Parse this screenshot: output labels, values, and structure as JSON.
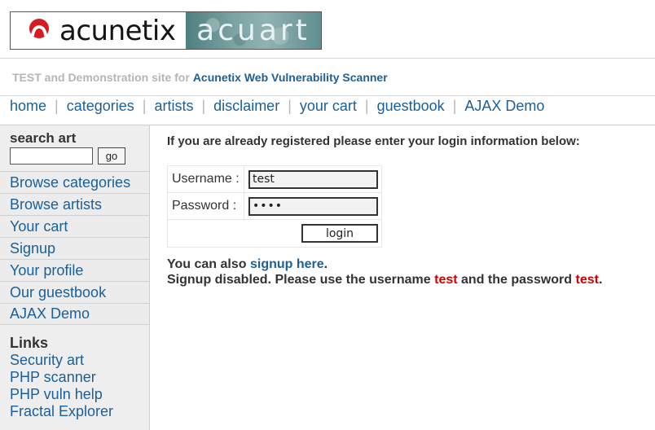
{
  "header": {
    "brand": "acunetix",
    "site_name": "acuart",
    "subtitle_muted": "TEST and Demonstration site for",
    "subtitle_link": "Acunetix Web Vulnerability Scanner"
  },
  "topnav": {
    "items": [
      "home",
      "categories",
      "artists",
      "disclaimer",
      "your cart",
      "guestbook",
      "AJAX Demo"
    ]
  },
  "sidebar": {
    "search_label": "search art",
    "search_input_value": "",
    "search_button": "go",
    "items": [
      "Browse categories",
      "Browse artists",
      "Your cart",
      "Signup",
      "Your profile",
      "Our guestbook",
      "AJAX Demo"
    ],
    "links_title": "Links",
    "links": [
      "Security art",
      "PHP scanner",
      "PHP vuln help",
      "Fractal Explorer"
    ]
  },
  "main": {
    "intro": "If you are already registered please enter your login information below:",
    "username_label": "Username :",
    "username_value": "test",
    "password_label": "Password :",
    "password_value_masked": "••••",
    "login_button": "login",
    "note_prefix": "You can also",
    "note_link": "signup here",
    "note_suffix": ".",
    "disabled_prefix": "Signup disabled. Please use the username",
    "disabled_username": "test",
    "disabled_middle": "and the password",
    "disabled_password": "test",
    "disabled_suffix": "."
  },
  "colors": {
    "link_blue": "#1b5f98",
    "accent_red": "#d10000",
    "sidebar_bg": "#eeeeee",
    "logo_teal": "#7aa3a2"
  },
  "icons": [
    "acunetix-logo-icon"
  ]
}
